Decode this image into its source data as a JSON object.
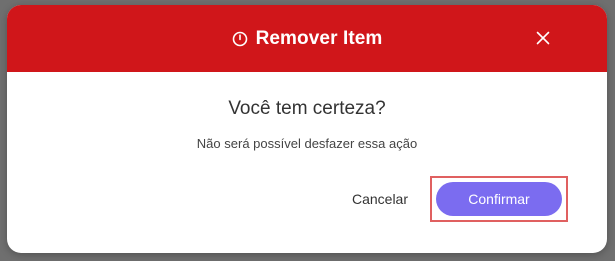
{
  "dialog": {
    "title": "Remover Item",
    "title_icon": "clock-icon",
    "close_icon": "close-icon",
    "question": "Você tem certeza?",
    "message": "Não será possível desfazer essa ação",
    "cancel_label": "Cancelar",
    "confirm_label": "Confirmar"
  },
  "colors": {
    "header_bg": "#d0161a",
    "confirm_bg": "#7b6cf0",
    "highlight_border": "#e06060",
    "overlay": "#6f6f6f"
  }
}
